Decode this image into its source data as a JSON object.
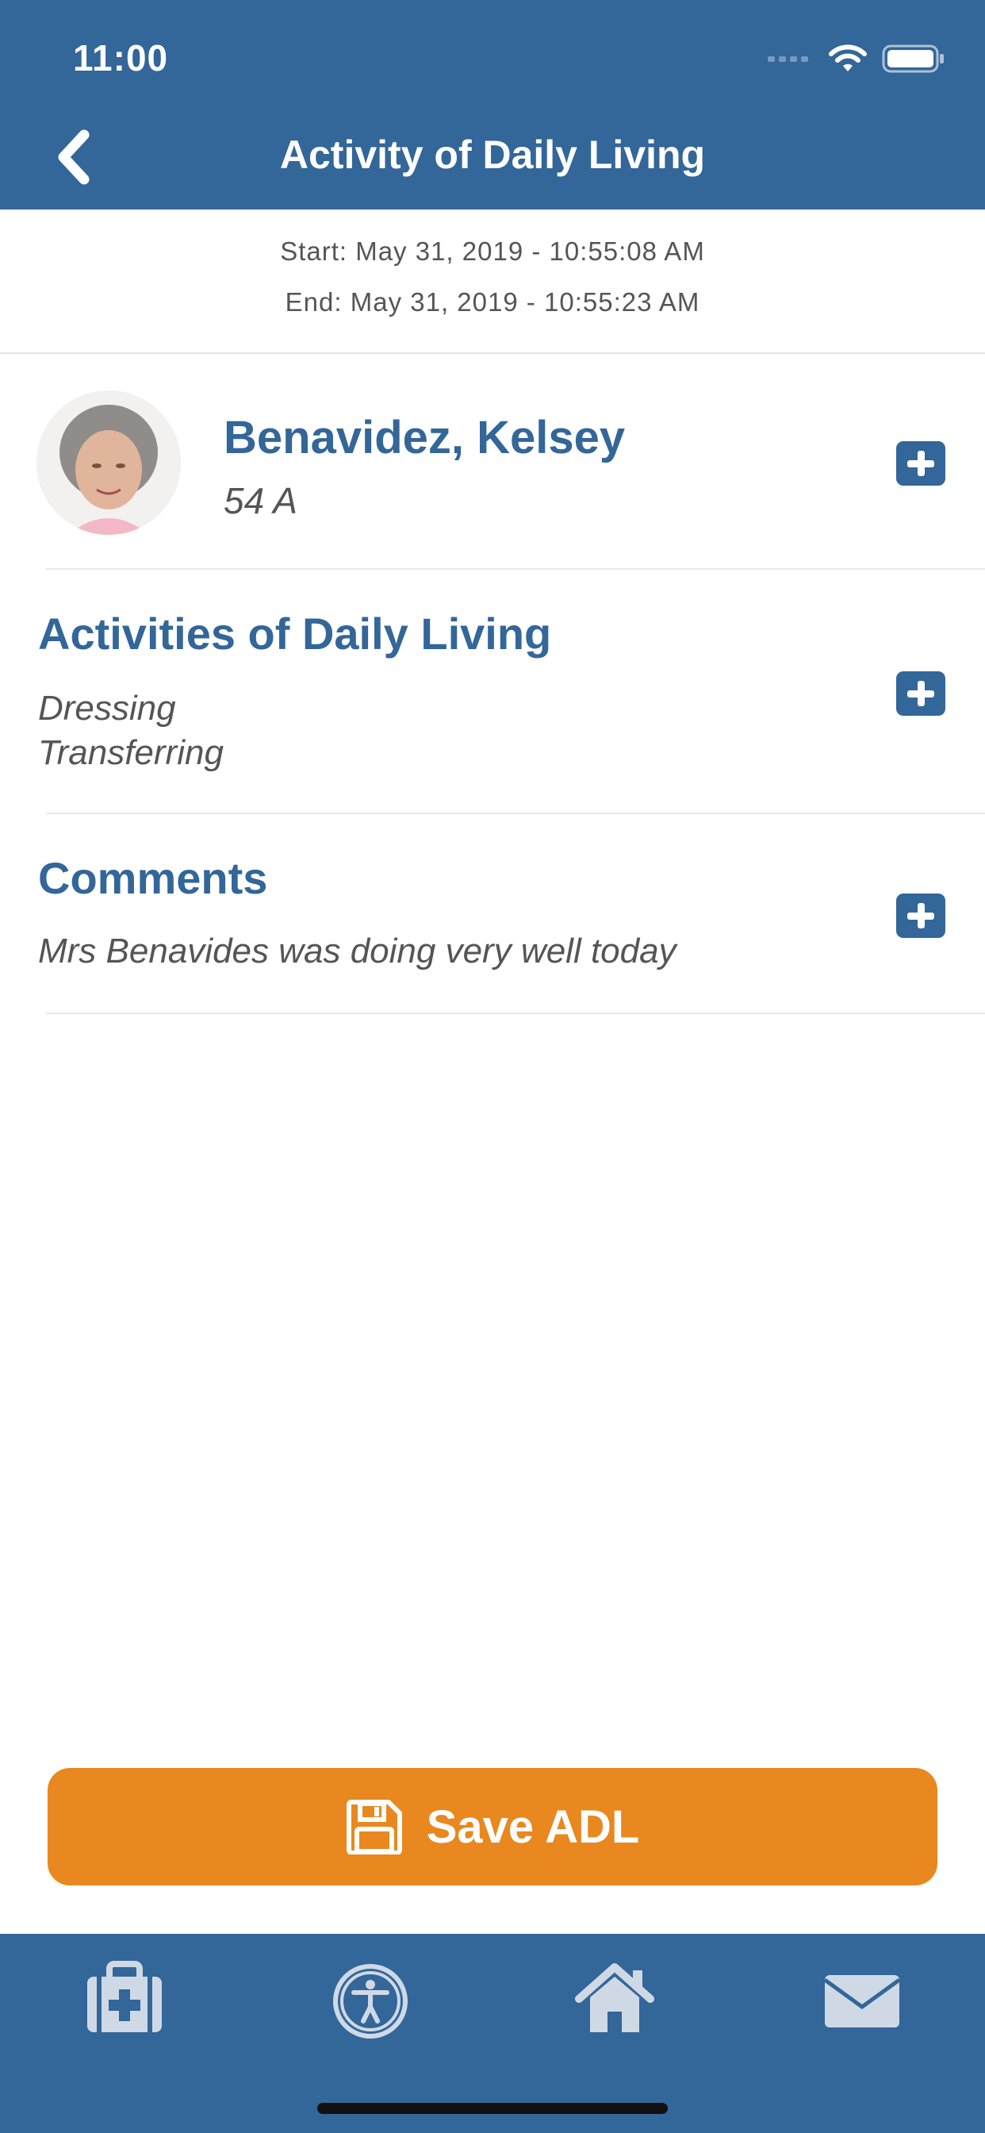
{
  "status_bar": {
    "time": "11:00"
  },
  "nav": {
    "title": "Activity of Daily Living",
    "back_icon": "chevron-left-icon"
  },
  "session": {
    "start": "Start: May 31, 2019 - 10:55:08 AM",
    "end": "End: May 31, 2019 - 10:55:23 AM"
  },
  "resident": {
    "name": "Benavidez, Kelsey",
    "room": "54 A"
  },
  "adl": {
    "title": "Activities of Daily Living",
    "items": [
      "Dressing",
      "Transferring"
    ]
  },
  "comments": {
    "title": "Comments",
    "text": "Mrs Benavides was doing very well today"
  },
  "save": {
    "label": "Save ADL",
    "icon": "floppy-disk-icon"
  },
  "tabs": [
    {
      "icon": "medical-kit-icon"
    },
    {
      "icon": "accessibility-icon"
    },
    {
      "icon": "home-icon"
    },
    {
      "icon": "mail-icon"
    }
  ],
  "colors": {
    "primary": "#336699",
    "accent": "#e8881f",
    "text_gray": "#555555"
  }
}
